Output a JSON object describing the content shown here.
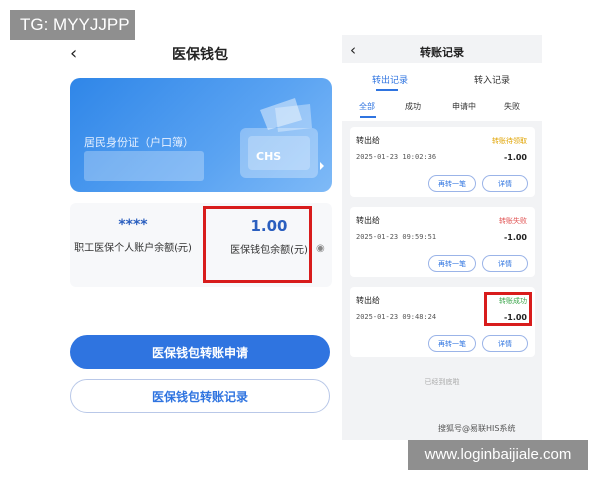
{
  "overlays": {
    "top_left": "TG: MYYJJPP",
    "bottom_right": "www.loginbaijiale.com"
  },
  "left": {
    "title": "医保钱包",
    "card": {
      "label": "居民身份证（户口簿）",
      "logo_text": "CHS"
    },
    "balances": [
      {
        "value": "****",
        "label": "职工医保个人账户余额(元)"
      },
      {
        "value": "1.00",
        "label": "医保钱包余额(元)"
      }
    ],
    "buttons": {
      "transfer_apply": "医保钱包转账申请",
      "transfer_records": "医保钱包转账记录"
    }
  },
  "right": {
    "title": "转账记录",
    "tabs": [
      "转出记录",
      "转入记录"
    ],
    "filters": [
      "全部",
      "成功",
      "申请中",
      "失败"
    ],
    "records": [
      {
        "name": "转出给",
        "status": "转账待领取",
        "status_color": "#e0a300",
        "time": "2025-01-23 10:02:36",
        "amount": "-1.00",
        "btn_again": "再转一笔",
        "btn_detail": "详情"
      },
      {
        "name": "转出给",
        "status": "转账失败",
        "status_color": "#e05050",
        "time": "2025-01-23 09:59:51",
        "amount": "-1.00",
        "btn_again": "再转一笔",
        "btn_detail": "详情"
      },
      {
        "name": "转出给",
        "status": "转账成功",
        "status_color": "#3aa54a",
        "time": "2025-01-23 09:48:24",
        "amount": "-1.00",
        "btn_again": "再转一笔",
        "btn_detail": "详情"
      }
    ],
    "end_note": "已经到底啦",
    "credit": "搜狐号@易联HIS系统"
  },
  "colors": {
    "primary": "#2f74e0",
    "highlight": "#d81c1c"
  }
}
